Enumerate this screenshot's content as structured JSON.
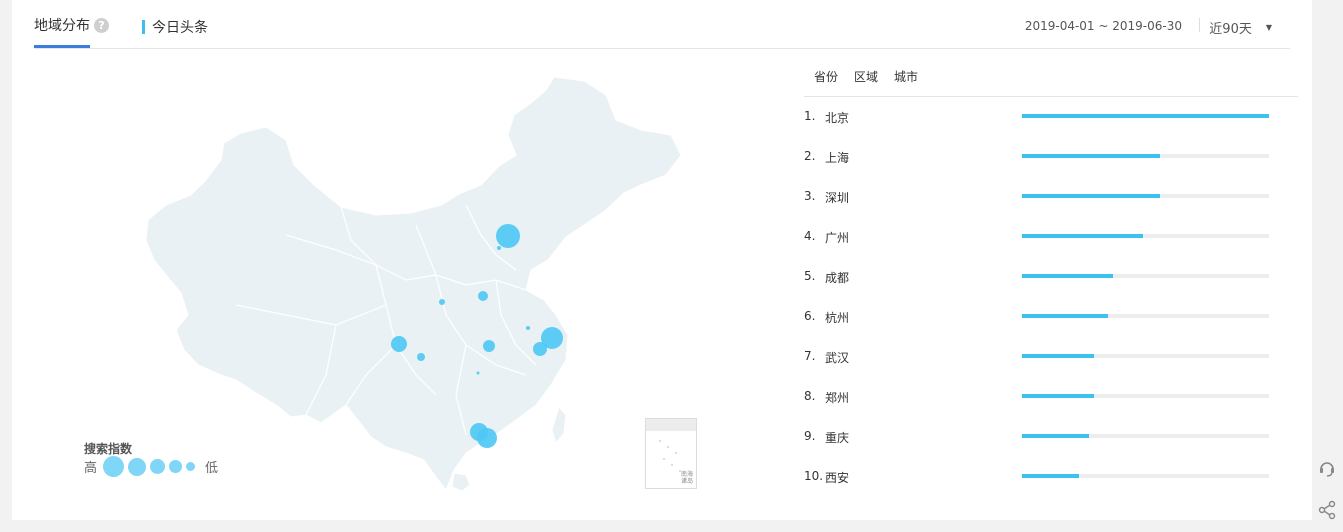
{
  "header": {
    "tab_label": "地域分布",
    "help_glyph": "?",
    "source_label": "今日头条",
    "date_range": "2019-04-01 ~ 2019-06-30",
    "period_label": "近90天"
  },
  "legend": {
    "title": "搜索指数",
    "high": "高",
    "low": "低"
  },
  "inset": {
    "label_line1": "南海",
    "label_line2": "诸岛"
  },
  "rank_tabs": [
    "省份",
    "区域",
    "城市"
  ],
  "ranking": [
    {
      "rank": "1.",
      "name": "北京",
      "value": 1.0
    },
    {
      "rank": "2.",
      "name": "上海",
      "value": 0.56
    },
    {
      "rank": "3.",
      "name": "深圳",
      "value": 0.56
    },
    {
      "rank": "4.",
      "name": "广州",
      "value": 0.49
    },
    {
      "rank": "5.",
      "name": "成都",
      "value": 0.37
    },
    {
      "rank": "6.",
      "name": "杭州",
      "value": 0.35
    },
    {
      "rank": "7.",
      "name": "武汉",
      "value": 0.29
    },
    {
      "rank": "8.",
      "name": "郑州",
      "value": 0.29
    },
    {
      "rank": "9.",
      "name": "重庆",
      "value": 0.27
    },
    {
      "rank": "10.",
      "name": "西安",
      "value": 0.23
    }
  ],
  "colors": {
    "accent": "#3b7ddb",
    "bar": "#3cc2f0",
    "bubble": "#4cc8f5",
    "map_fill": "#e9f1f4"
  },
  "icons": [
    "help-icon",
    "caret-down-icon",
    "headset-icon",
    "share-icon"
  ]
}
